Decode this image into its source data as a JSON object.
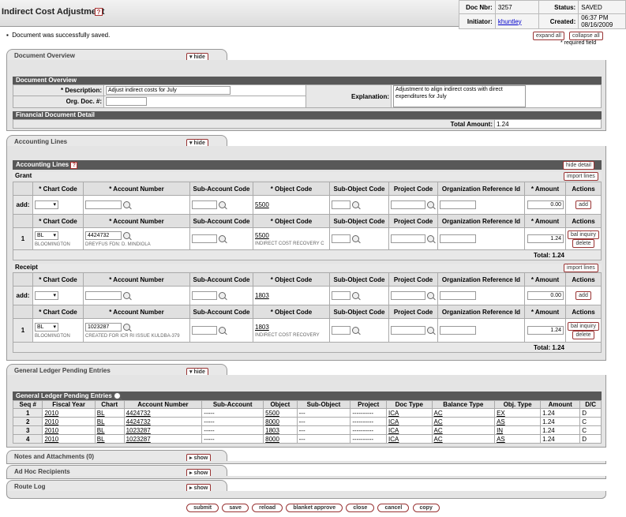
{
  "header": {
    "title": "Indirect Cost Adjustment",
    "help": "?",
    "doc_nbr_label": "Doc Nbr:",
    "doc_nbr": "3257",
    "status_label": "Status:",
    "status": "SAVED",
    "initiator_label": "Initiator:",
    "initiator": "khuntley",
    "created_label": "Created:",
    "created": "06:37 PM 08/16/2009"
  },
  "message": "Document was successfully saved.",
  "expand_all": "expand all",
  "collapse_all": "collapse all",
  "required_note": "* required field",
  "tabs": {
    "doc_overview": "Document Overview",
    "accounting_lines": "Accounting Lines",
    "glpe": "General Ledger Pending Entries",
    "notes": "Notes and Attachments (0)",
    "adhoc": "Ad Hoc Recipients",
    "route_log": "Route Log",
    "hide": "▾ hide",
    "show": "▸ show"
  },
  "overview": {
    "section": "Document Overview",
    "desc_label": "* Description:",
    "desc_value": "Adjust indirect costs for July",
    "org_label": "Org. Doc. #:",
    "org_value": "",
    "expl_label": "Explanation:",
    "expl_value": "Adjustment to align indirect costs with direct expenditures for July",
    "fin_section": "Financial Document Detail",
    "total_label": "Total Amount:",
    "total_value": "1.24"
  },
  "accounting": {
    "section": "Accounting Lines",
    "hide_detail": "hide detail",
    "import_lines": "import lines",
    "add_label": "add:",
    "add_btn": "add",
    "bal_inquiry": "bal inquiry",
    "delete": "delete",
    "cols": {
      "chart": "* Chart Code",
      "account": "* Account Number",
      "subacct": "Sub-Account Code",
      "object": "* Object Code",
      "subobj": "Sub-Object Code",
      "project": "Project Code",
      "orgref": "Organization Reference Id",
      "amount": "* Amount",
      "actions": "Actions"
    },
    "grant": {
      "title": "Grant",
      "add_object": "5500",
      "add_amount": "0.00",
      "seq": "1",
      "chart": "BL",
      "chart_name": "BLOOMINGTON",
      "account": "4424732",
      "account_name": "DREYFUS FDN: D. MINDIOLA",
      "object": "5500",
      "object_name": "INDIRECT COST RECOVERY C",
      "amount": "1.24",
      "total": "Total: 1.24"
    },
    "receipt": {
      "title": "Receipt",
      "add_object": "1803",
      "add_amount": "0.00",
      "seq": "1",
      "chart": "BL",
      "chart_name": "BLOOMINGTON",
      "account": "1023287",
      "account_name": "CREATED FOR ICR RI ISSUE KULDBA-379",
      "object": "1803",
      "object_name": "INDIRECT COST RECOVERY",
      "amount": "1.24",
      "total": "Total: 1.24"
    }
  },
  "glpe": {
    "section": "General Ledger Pending Entries",
    "cols": [
      "Seq #",
      "Fiscal Year",
      "Chart",
      "Account Number",
      "Sub-Account",
      "Object",
      "Sub-Object",
      "Project",
      "Doc Type",
      "Balance Type",
      "Obj. Type",
      "Amount",
      "D/C"
    ],
    "rows": [
      [
        "1",
        "2010",
        "BL",
        "4424732",
        "-----",
        "5500",
        "---",
        "----------",
        "ICA",
        "AC",
        "EX",
        "1.24",
        "D"
      ],
      [
        "2",
        "2010",
        "BL",
        "4424732",
        "-----",
        "8000",
        "---",
        "----------",
        "ICA",
        "AC",
        "AS",
        "1.24",
        "C"
      ],
      [
        "3",
        "2010",
        "BL",
        "1023287",
        "-----",
        "1803",
        "---",
        "----------",
        "ICA",
        "AC",
        "IN",
        "1.24",
        "C"
      ],
      [
        "4",
        "2010",
        "BL",
        "1023287",
        "-----",
        "8000",
        "---",
        "----------",
        "ICA",
        "AC",
        "AS",
        "1.24",
        "D"
      ]
    ]
  },
  "buttons": {
    "submit": "submit",
    "save": "save",
    "reload": "reload",
    "blanket": "blanket approve",
    "close": "close",
    "cancel": "cancel",
    "copy": "copy"
  }
}
